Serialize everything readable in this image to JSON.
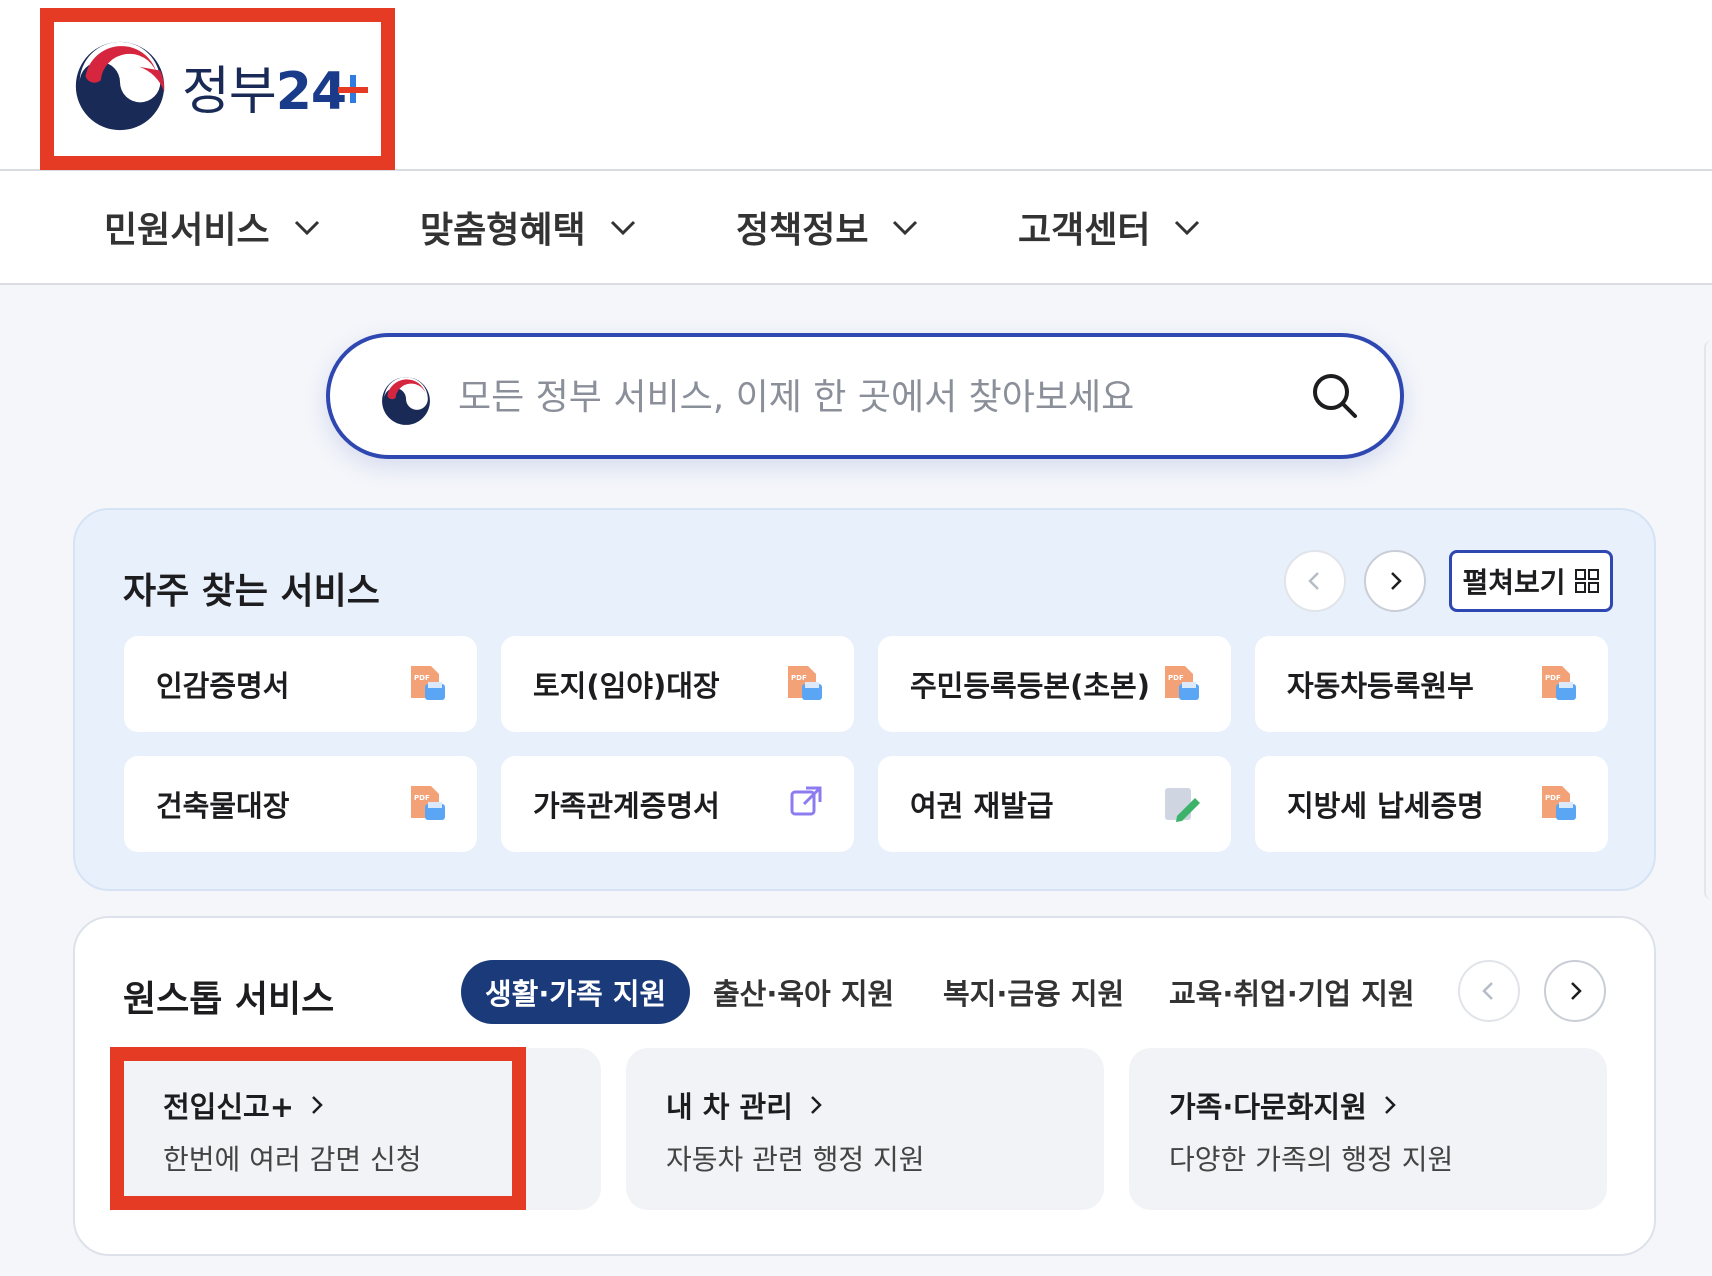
{
  "header": {
    "logo_text": "정부",
    "logo_num": "24",
    "colors": {
      "accent_red": "#e53b25",
      "brand_navy": "#1a3a7a",
      "brand_blue": "#2f47b0"
    }
  },
  "nav": {
    "items": [
      {
        "label": "민원서비스"
      },
      {
        "label": "맞춤형혜택"
      },
      {
        "label": "정책정보"
      },
      {
        "label": "고객센터"
      }
    ]
  },
  "search": {
    "placeholder": "모든 정부 서비스, 이제 한 곳에서 찾아보세요",
    "value": ""
  },
  "frequent": {
    "title": "자주 찾는 서비스",
    "expand_label": "펼쳐보기",
    "cards": [
      {
        "label": "인감증명서",
        "icon": "pdf-icon"
      },
      {
        "label": "토지(임야)대장",
        "icon": "pdf-icon"
      },
      {
        "label": "주민등록등본(초본)",
        "icon": "pdf-icon"
      },
      {
        "label": "자동차등록원부",
        "icon": "pdf-icon"
      },
      {
        "label": "건축물대장",
        "icon": "pdf-icon"
      },
      {
        "label": "가족관계증명서",
        "icon": "external-link-icon"
      },
      {
        "label": "여권 재발급",
        "icon": "edit-icon"
      },
      {
        "label": "지방세 납세증명",
        "icon": "pdf-icon"
      }
    ]
  },
  "onestop": {
    "title": "원스톱 서비스",
    "tabs": [
      {
        "label": "생활·가족 지원",
        "active": true
      },
      {
        "label": "출산·육아 지원",
        "active": false
      },
      {
        "label": "복지·금융 지원",
        "active": false
      },
      {
        "label": "교육·취업·기업 지원",
        "active": false
      }
    ],
    "services": [
      {
        "title": "전입신고+",
        "desc": "한번에 여러 감면 신청"
      },
      {
        "title": "내 차 관리",
        "desc": "자동차 관련 행정 지원"
      },
      {
        "title": "가족·다문화지원",
        "desc": "다양한 가족의 행정 지원"
      }
    ]
  }
}
